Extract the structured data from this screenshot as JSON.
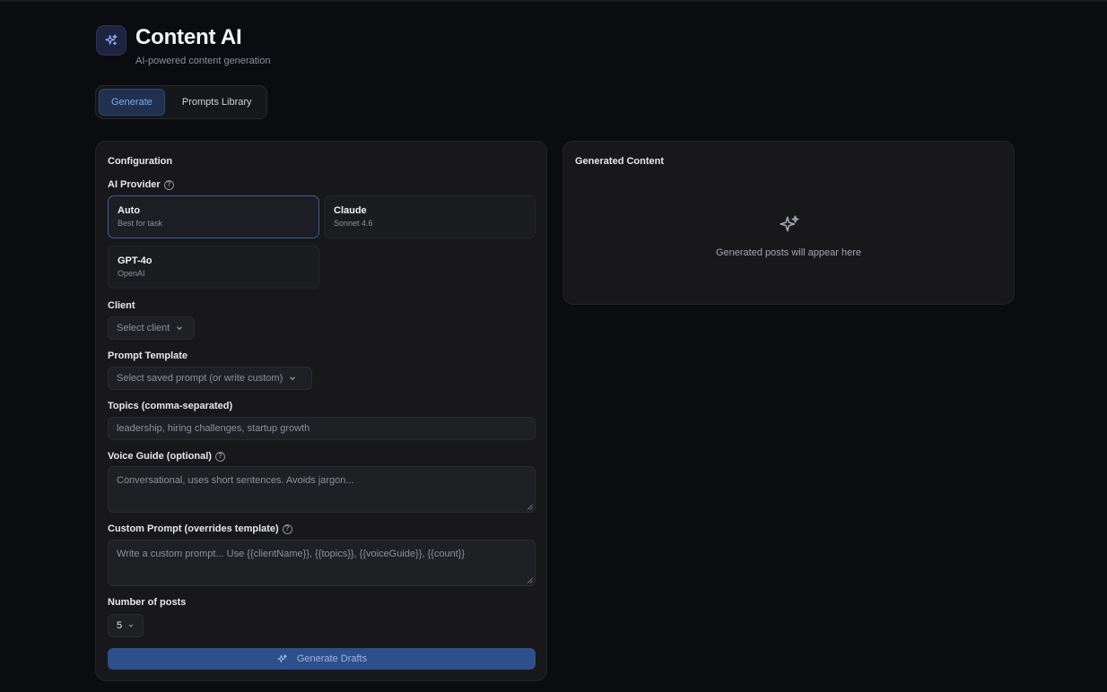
{
  "header": {
    "title": "Content AI",
    "subtitle": "AI-powered content generation"
  },
  "tabs": [
    {
      "label": "Generate",
      "active": true
    },
    {
      "label": "Prompts Library",
      "active": false
    }
  ],
  "config": {
    "title": "Configuration",
    "provider_label": "AI Provider",
    "providers": [
      {
        "name": "Auto",
        "desc": "Best for task",
        "selected": true
      },
      {
        "name": "Claude",
        "desc": "Sonnet 4.6",
        "selected": false
      },
      {
        "name": "GPT-4o",
        "desc": "OpenAI",
        "selected": false
      }
    ],
    "client_label": "Client",
    "client_placeholder": "Select client",
    "template_label": "Prompt Template",
    "template_placeholder": "Select saved prompt (or write custom)",
    "topics_label": "Topics (comma-separated)",
    "topics_placeholder": "leadership, hiring challenges, startup growth",
    "voice_label": "Voice Guide (optional)",
    "voice_placeholder": "Conversational, uses short sentences. Avoids jargon...",
    "custom_label": "Custom Prompt (overrides template)",
    "custom_placeholder": "Write a custom prompt... Use {{clientName}}, {{topics}}, {{voiceGuide}}, {{count}}",
    "count_label": "Number of posts",
    "count_value": "5",
    "generate_label": "Generate Drafts"
  },
  "output": {
    "title": "Generated Content",
    "empty_text": "Generated posts will appear here"
  },
  "colors": {
    "accent": "#2d4f8c",
    "selected_border": "#3a5a9c",
    "background": "#0b0c0f"
  }
}
